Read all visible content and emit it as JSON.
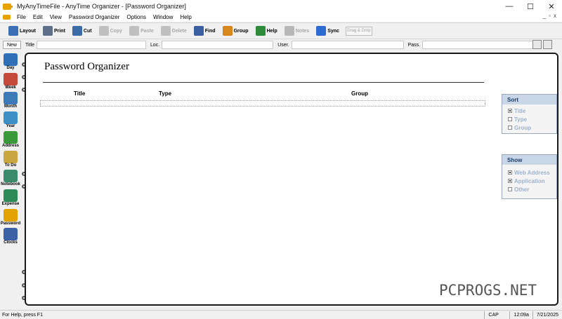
{
  "window": {
    "title": "MyAnyTimeFile - AnyTime Organizer - [Password Organizer]",
    "minimize_glyph": "—",
    "maximize_glyph": "☐",
    "close_glyph": "✕"
  },
  "menu": {
    "items": [
      "File",
      "Edit",
      "View",
      "Password Organizer",
      "Options",
      "Window",
      "Help"
    ],
    "mdi": [
      "_",
      "▫",
      "x"
    ]
  },
  "toolbar": {
    "buttons": [
      {
        "label": "Layout",
        "icon": "layout-icon",
        "color": "#3a6fb5",
        "enabled": true
      },
      {
        "label": "Print",
        "icon": "printer-icon",
        "color": "#5e6f8a",
        "enabled": true
      },
      {
        "label": "Cut",
        "icon": "scissors-icon",
        "color": "#3b6ca8",
        "enabled": true
      },
      {
        "label": "Copy",
        "icon": "copy-icon",
        "color": "#c0c0c0",
        "enabled": false
      },
      {
        "label": "Paste",
        "icon": "paste-icon",
        "color": "#c0c0c0",
        "enabled": false
      },
      {
        "label": "Delete",
        "icon": "delete-icon",
        "color": "#c0c0c0",
        "enabled": false
      },
      {
        "label": "Find",
        "icon": "magnifier-icon",
        "color": "#3b5fa0",
        "enabled": true
      },
      {
        "label": "Group",
        "icon": "group-icon",
        "color": "#d8871c",
        "enabled": true
      },
      {
        "label": "Help",
        "icon": "help-icon",
        "color": "#2e8b3a",
        "enabled": true
      },
      {
        "label": "Notes",
        "icon": "notes-icon",
        "color": "#b8b8b8",
        "enabled": false
      },
      {
        "label": "Sync",
        "icon": "sync-icon",
        "color": "#2d6bd0",
        "enabled": true
      }
    ],
    "drag_drop": "Drag & Drop"
  },
  "search": {
    "new_label": "New",
    "fields": [
      {
        "label": "Title",
        "value": ""
      },
      {
        "label": "Loc.",
        "value": ""
      },
      {
        "label": "User.",
        "value": ""
      },
      {
        "label": "Pass.",
        "value": ""
      }
    ]
  },
  "nav": {
    "items": [
      {
        "label": "Day",
        "icon": "calendar-day-icon",
        "color": "#2f6fb8"
      },
      {
        "label": "Week",
        "icon": "calendar-week-icon",
        "color": "#c64a3c"
      },
      {
        "label": "Month",
        "icon": "calendar-month-icon",
        "color": "#3d7ab8"
      },
      {
        "label": "Year",
        "icon": "calendar-year-icon",
        "color": "#3b8fc4"
      },
      {
        "label": "Address",
        "icon": "address-icon",
        "color": "#3a9a3a"
      },
      {
        "label": "To Do",
        "icon": "todo-icon",
        "color": "#c9a640"
      },
      {
        "label": "Notebook",
        "icon": "notebook-icon",
        "color": "#3b8a6b"
      },
      {
        "label": "Expense",
        "icon": "expense-icon",
        "color": "#2e8b57"
      },
      {
        "label": "Password",
        "icon": "key-icon",
        "color": "#e2a300"
      },
      {
        "label": "Clocks",
        "icon": "clock-icon",
        "color": "#3b62a5"
      }
    ]
  },
  "page": {
    "title": "Password Organizer",
    "columns": [
      "Title",
      "Type",
      "Group"
    ]
  },
  "sort": {
    "heading": "Sort",
    "options": [
      {
        "label": "Title",
        "checked": true
      },
      {
        "label": "Type",
        "checked": false
      },
      {
        "label": "Group",
        "checked": false
      }
    ]
  },
  "show": {
    "heading": "Show",
    "options": [
      {
        "label": "Web Address",
        "checked": true
      },
      {
        "label": "Application",
        "checked": true
      },
      {
        "label": "Other",
        "checked": false
      }
    ]
  },
  "status": {
    "help": "For Help, press F1",
    "cap": "CAP",
    "time": "12:09a",
    "date": "7/21/2025"
  },
  "watermark": "PCPROGS.NET"
}
